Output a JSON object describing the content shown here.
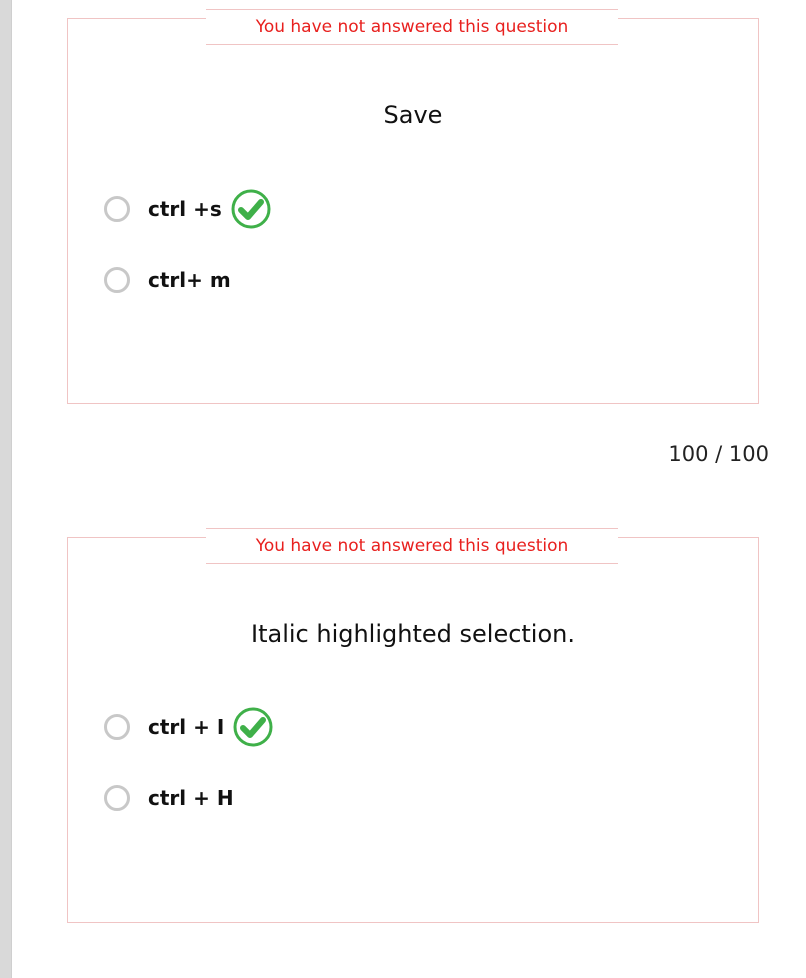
{
  "questions": [
    {
      "status": "You have not answered this question",
      "text": "Save",
      "options": [
        {
          "label": "ctrl +s",
          "correct": true,
          "selected": false
        },
        {
          "label": "ctrl+ m",
          "correct": false,
          "selected": false
        }
      ]
    },
    {
      "status": "You have not answered this question",
      "text": "Italic highlighted selection.",
      "options": [
        {
          "label": "ctrl + I",
          "correct": true,
          "selected": false
        },
        {
          "label": "ctrl + H",
          "correct": false,
          "selected": false
        }
      ]
    }
  ],
  "score": {
    "text": "100 / 100"
  },
  "colors": {
    "status_text": "#e8201e",
    "card_border": "#f0c4c4",
    "correct_green": "#3fb049",
    "radio_border": "#c8c8c8"
  },
  "icons": {
    "correct": "check-circle-icon",
    "option": "radio-button"
  }
}
